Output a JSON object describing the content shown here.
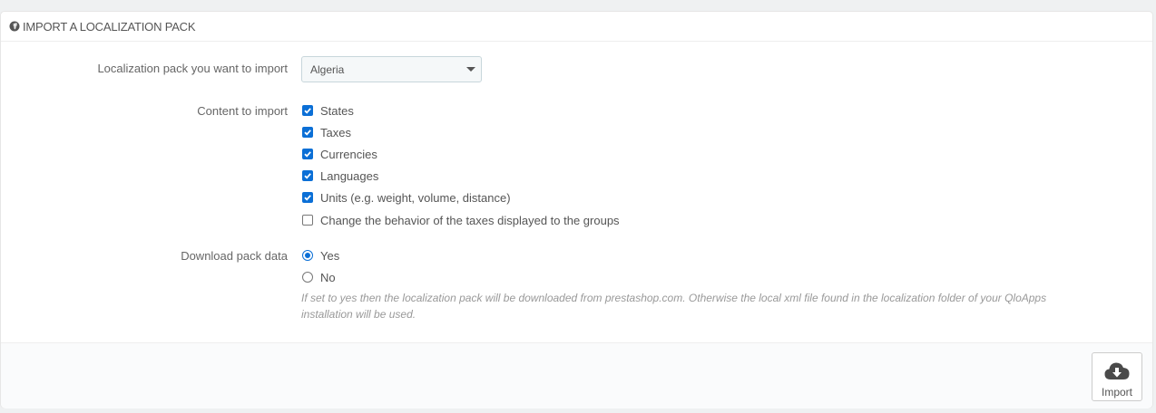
{
  "panel": {
    "title": "IMPORT A LOCALIZATION PACK",
    "title_icon": "globe-icon"
  },
  "form": {
    "pack_label": "Localization pack you want to import",
    "pack_selected": "Algeria",
    "content_label": "Content to import",
    "content_options": [
      {
        "label": "States",
        "checked": true
      },
      {
        "label": "Taxes",
        "checked": true
      },
      {
        "label": "Currencies",
        "checked": true
      },
      {
        "label": "Languages",
        "checked": true
      },
      {
        "label": "Units (e.g. weight, volume, distance)",
        "checked": true
      },
      {
        "label": "Change the behavior of the taxes displayed to the groups",
        "checked": false
      }
    ],
    "download_label": "Download pack data",
    "download_options": [
      {
        "label": "Yes",
        "selected": true
      },
      {
        "label": "No",
        "selected": false
      }
    ],
    "download_help": "If set to yes then the localization pack will be downloaded from prestashop.com. Otherwise the local xml file found in the localization folder of your QloApps installation will be used."
  },
  "footer": {
    "import_label": "Import",
    "import_icon": "cloud-download-icon"
  },
  "colors": {
    "accent": "#0b6fd6",
    "background": "#eff1f2"
  }
}
